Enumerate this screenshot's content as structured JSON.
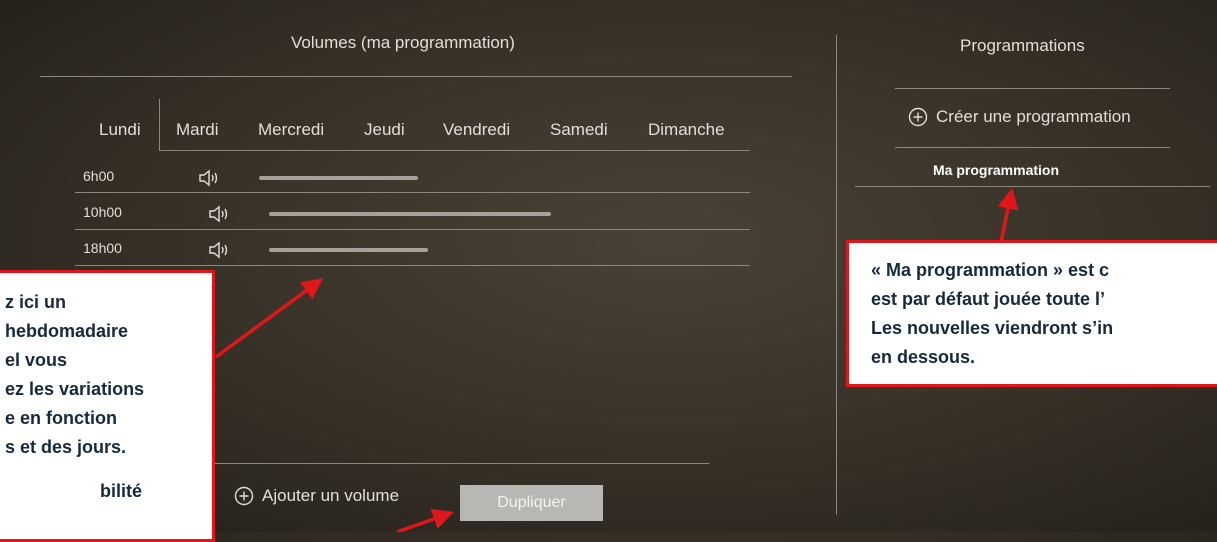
{
  "volumes_panel": {
    "title": "Volumes (ma programmation)",
    "tabs": [
      "Lundi",
      "Mardi",
      "Mercredi",
      "Jeudi",
      "Vendredi",
      "Samedi",
      "Dimanche"
    ],
    "active_tab": "Lundi",
    "rows": [
      {
        "time": "6h00",
        "volume_level": 0.52
      },
      {
        "time": "10h00",
        "volume_level": 0.92
      },
      {
        "time": "18h00",
        "volume_level": 0.52
      }
    ],
    "add_volume_label": "Ajouter un volume",
    "duplicate_label": "Dupliquer"
  },
  "programs_panel": {
    "title": "Programmations",
    "create_label": "Créer une programmation",
    "items": [
      "Ma programmation"
    ]
  },
  "callout_left": {
    "lines": [
      "z ici un",
      "hebdomadaire",
      "el vous",
      "ez les variations",
      "e en fonction",
      "s et des jours.",
      "",
      "bilité"
    ]
  },
  "callout_right": {
    "lines": [
      "« Ma programmation » est c",
      "est par défaut jouée toute l’",
      "Les nouvelles viendront s’in",
      "en dessous."
    ]
  },
  "colors": {
    "accent_red": "#e0161b",
    "callout_text": "#16293f",
    "button_bg": "#b9b7b4"
  }
}
